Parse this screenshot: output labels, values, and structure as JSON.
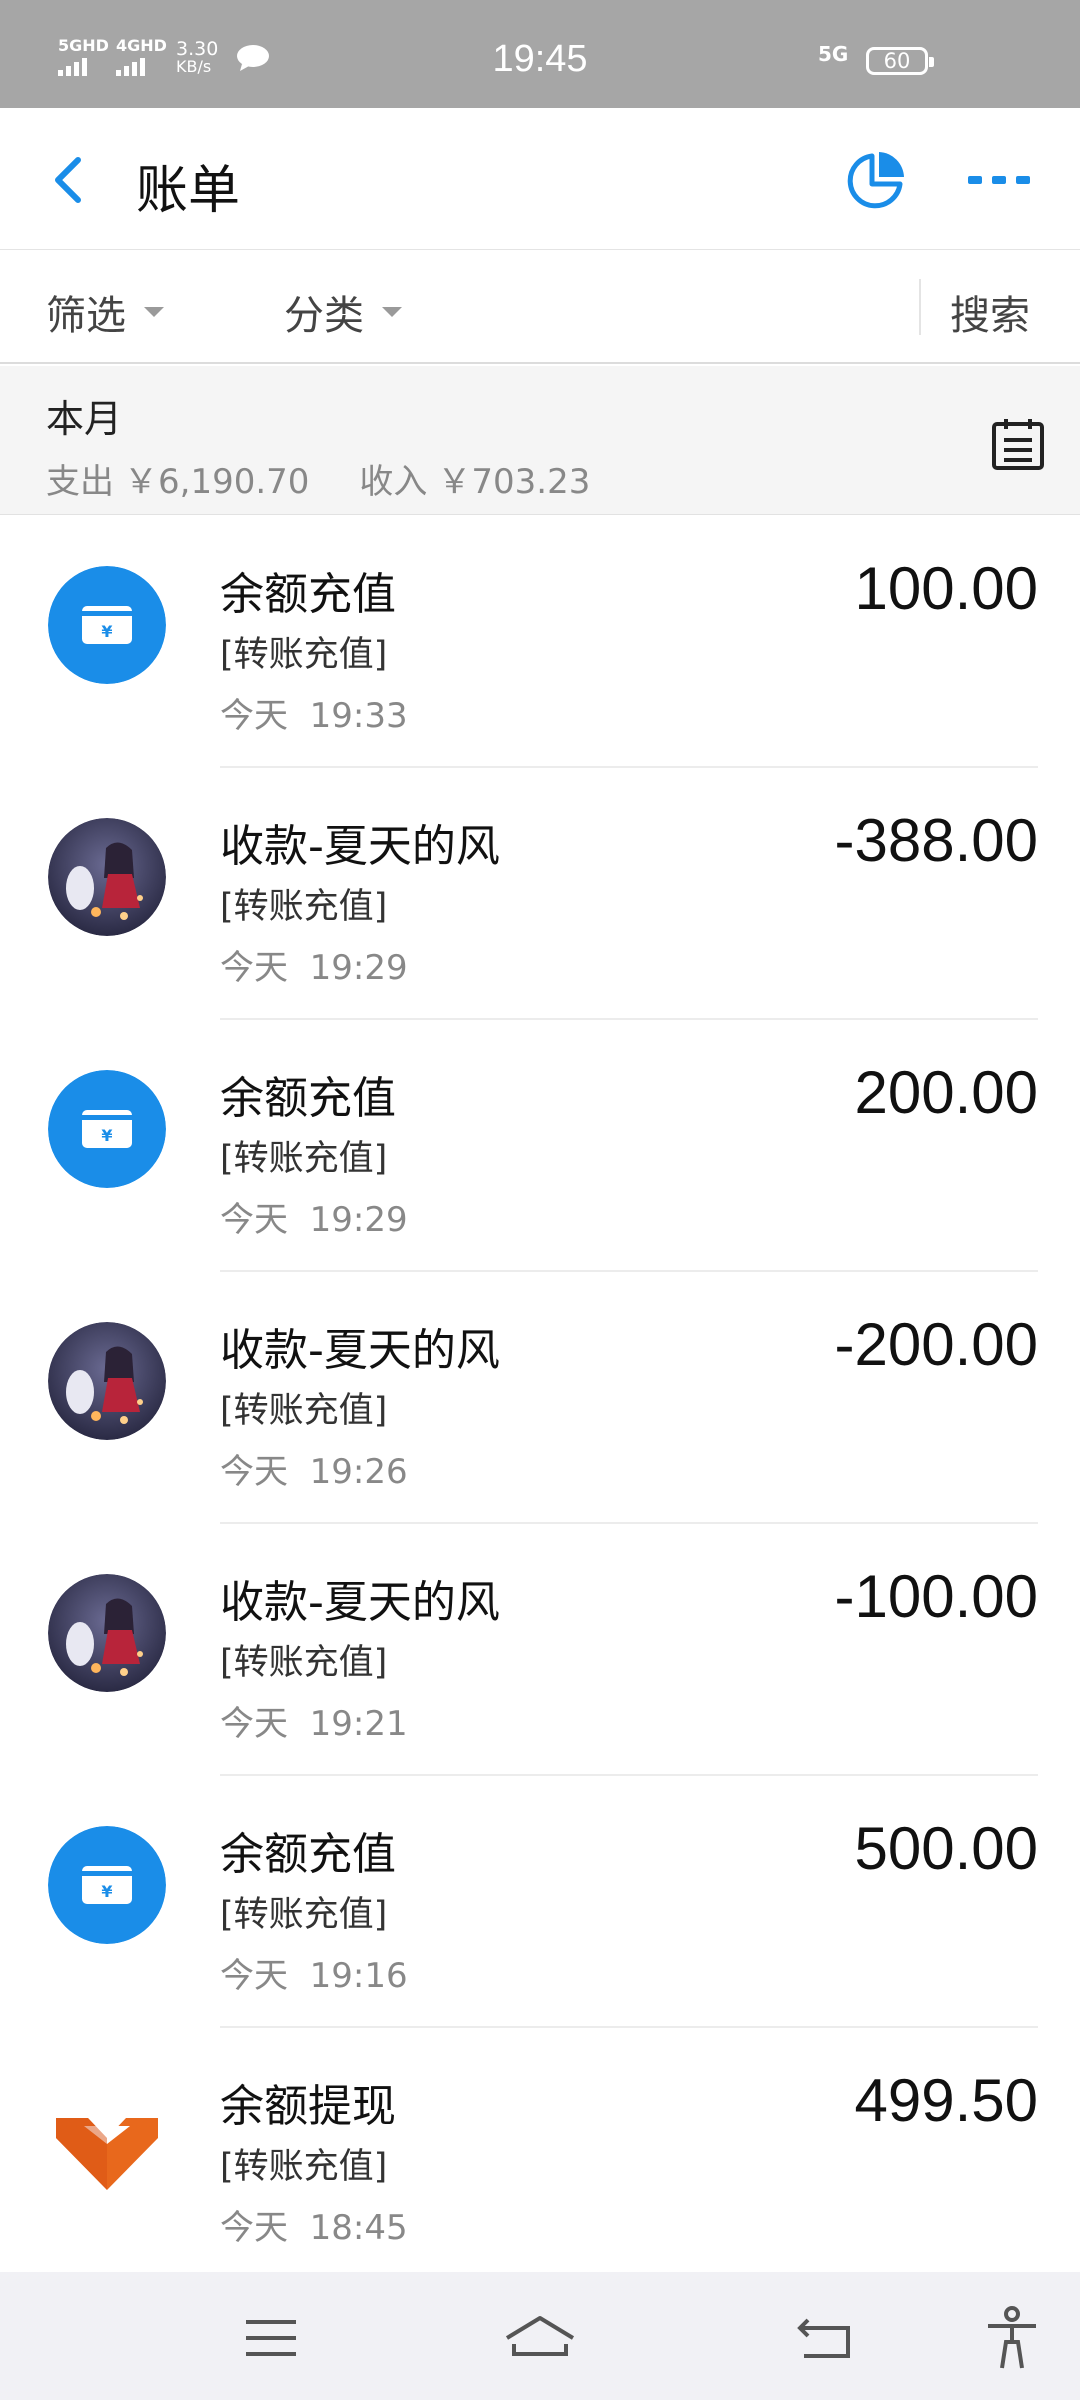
{
  "status_bar": {
    "sim1": "5GHD",
    "sim2": "4GHD",
    "speed_value": "3.30",
    "speed_unit": "KB/s",
    "time": "19:45",
    "network": "5G",
    "battery": "60"
  },
  "nav": {
    "title": "账单"
  },
  "filters": {
    "filter_label": "筛选",
    "category_label": "分类",
    "search_label": "搜索"
  },
  "summary": {
    "period": "本月",
    "expense_label": "支出",
    "expense_value": "￥6,190.70",
    "income_label": "收入",
    "income_value": "￥703.23"
  },
  "bills": [
    {
      "icon": "recharge-card-icon",
      "title": "余额充值",
      "category": "[转账充值]",
      "day": "今天",
      "time": "19:33",
      "amount": "100.00"
    },
    {
      "icon": "avatar-anime",
      "title": "收款-夏天的风",
      "category": "[转账充值]",
      "day": "今天",
      "time": "19:29",
      "amount": "-388.00"
    },
    {
      "icon": "recharge-card-icon",
      "title": "余额充值",
      "category": "[转账充值]",
      "day": "今天",
      "time": "19:29",
      "amount": "200.00"
    },
    {
      "icon": "avatar-anime",
      "title": "收款-夏天的风",
      "category": "[转账充值]",
      "day": "今天",
      "time": "19:26",
      "amount": "-200.00"
    },
    {
      "icon": "avatar-anime",
      "title": "收款-夏天的风",
      "category": "[转账充值]",
      "day": "今天",
      "time": "19:21",
      "amount": "-100.00"
    },
    {
      "icon": "recharge-card-icon",
      "title": "余额充值",
      "category": "[转账充值]",
      "day": "今天",
      "time": "19:16",
      "amount": "500.00"
    },
    {
      "icon": "bank-logo-icon",
      "title": "余额提现",
      "category": "[转账充值]",
      "day": "今天",
      "time": "18:45",
      "amount": "499.50"
    }
  ],
  "colors": {
    "accent": "#1a8de8",
    "status_bar": "#a6a6a6",
    "summary_bg": "#f5f5f5",
    "bank_logo": "#e8681c"
  }
}
